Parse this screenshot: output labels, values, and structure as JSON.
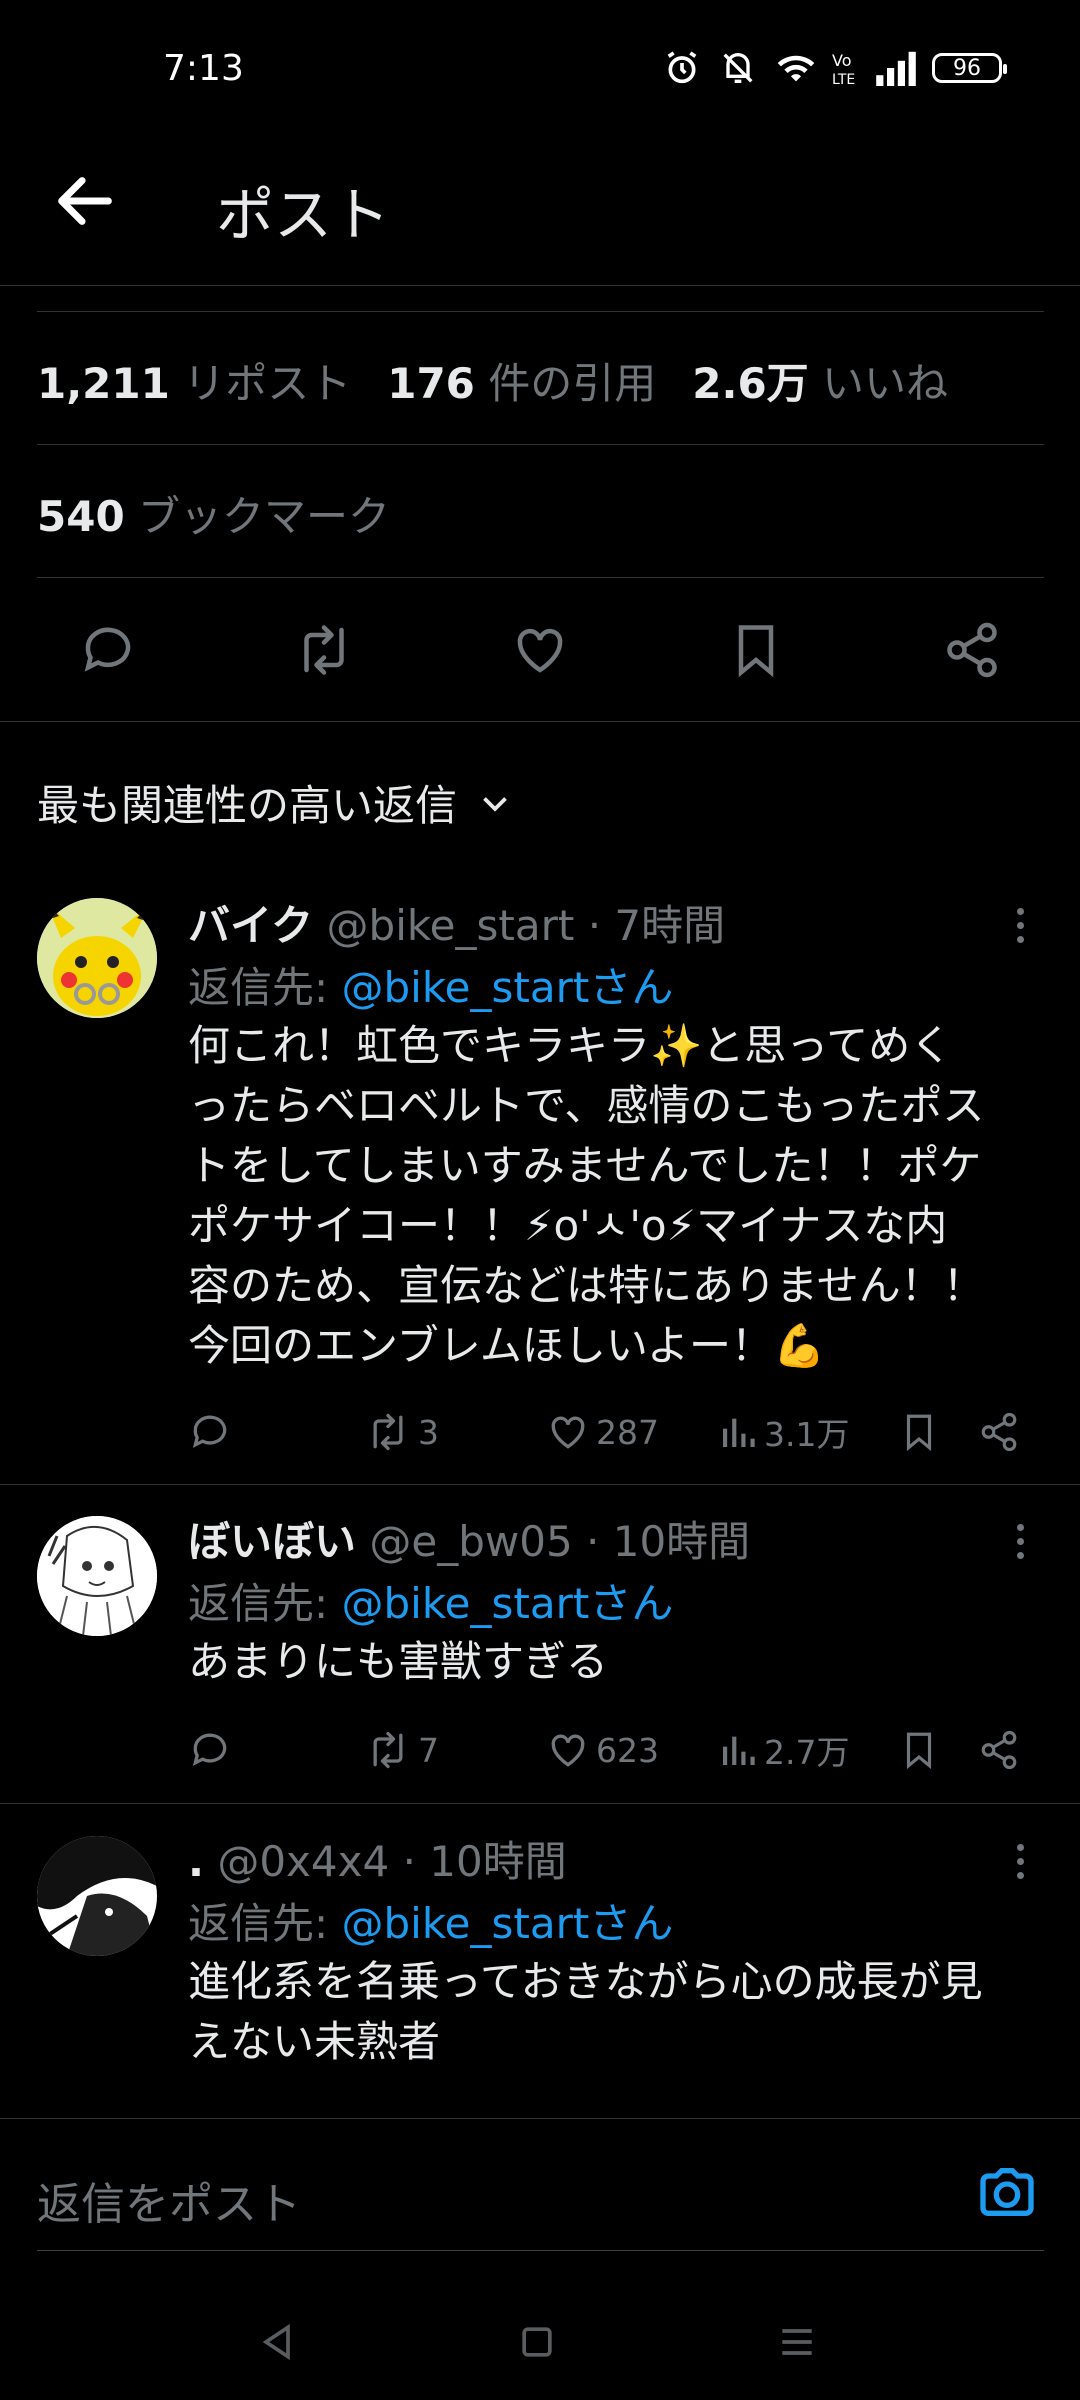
{
  "status_bar": {
    "time": "7:13",
    "battery": "96"
  },
  "header": {
    "title": "ポスト"
  },
  "stats": {
    "reposts_count": "1,211",
    "reposts_label": "リポスト",
    "quotes_count": "176",
    "quotes_label": "件の引用",
    "likes_count": "2.6万",
    "likes_label": "いいね",
    "bookmarks_count": "540",
    "bookmarks_label": "ブックマーク"
  },
  "sort": {
    "label": "最も関連性の高い返信"
  },
  "replies": [
    {
      "name": "バイク",
      "handle": "@bike_start",
      "time": "· 7時間",
      "reply_to_label": "返信先:",
      "reply_to": "@bike_startさん",
      "lines": [
        "何これ！虹色でキラキラ✨と思ってめく",
        "ったらベロベルトで、感情のこもったポス",
        "トをしてしまいすみませんでした！！ポケ",
        "ポケサイコー！！⚡o'ㅅ'o⚡マイナスな内",
        "容のため、宣伝などは特にありません！！",
        "今回のエンブレムほしいよー！💪"
      ],
      "reposts": "3",
      "likes": "287",
      "views": "3.1万"
    },
    {
      "name": "ぼいぼい",
      "handle": "@e_bw05",
      "time": "· 10時間",
      "reply_to_label": "返信先:",
      "reply_to": "@bike_startさん",
      "lines": [
        "あまりにも害獣すぎる"
      ],
      "reposts": "7",
      "likes": "623",
      "views": "2.7万"
    },
    {
      "name": ".",
      "handle": "@0x4x4",
      "time": "· 10時間",
      "reply_to_label": "返信先:",
      "reply_to": "@bike_startさん",
      "lines": [
        "進化系を名乗っておきながら心の成長が見",
        "えない未熟者"
      ]
    }
  ],
  "composer": {
    "placeholder": "返信をポスト"
  },
  "colors": {
    "background": "#000000",
    "text": "#e7e9ea",
    "muted": "#71767b",
    "accent": "#1d9bf0",
    "divider": "#2f3336"
  },
  "icons": [
    "back-arrow-icon",
    "reply-icon",
    "repost-icon",
    "like-icon",
    "bookmark-icon",
    "share-icon",
    "views-icon",
    "camera-icon",
    "more-icon",
    "chevron-down-icon"
  ]
}
